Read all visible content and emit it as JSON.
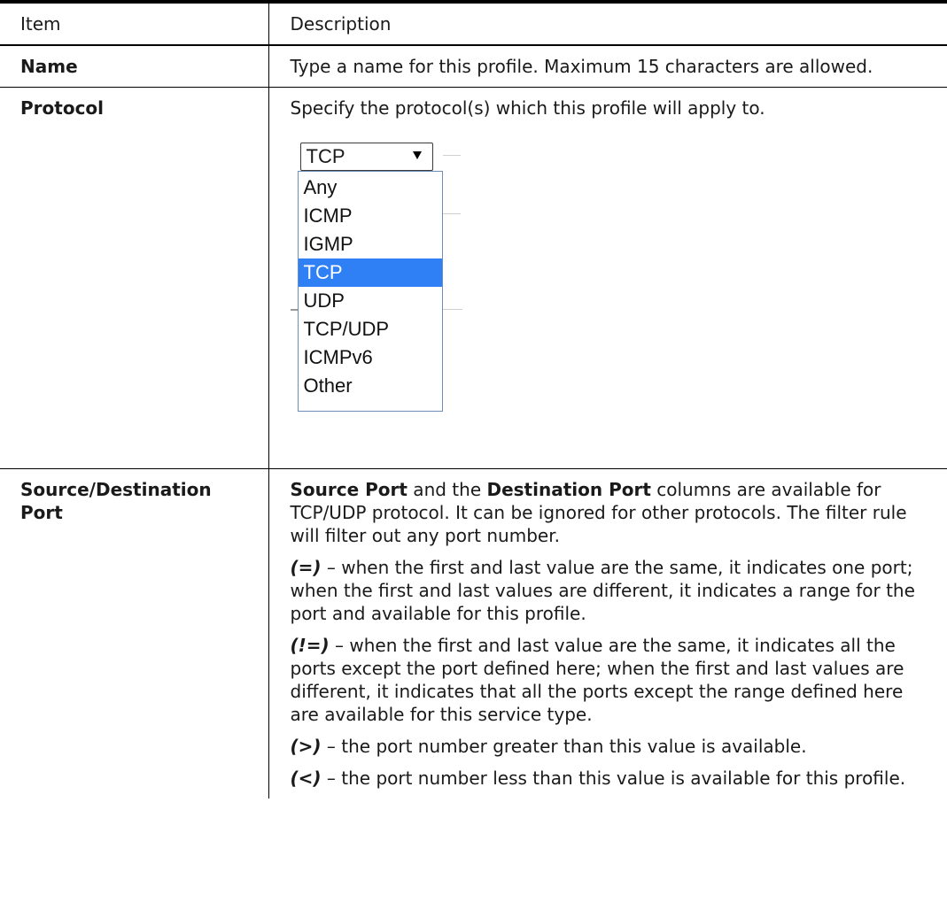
{
  "header": {
    "item": "Item",
    "description": "Description"
  },
  "rows": [
    {
      "item": "Name",
      "desc": "Type a name for this profile. Maximum 15 characters are allowed."
    },
    {
      "item": "Protocol",
      "desc": "Specify the protocol(s) which this profile will apply to.",
      "dropdown": {
        "selected": "TCP",
        "options": [
          "Any",
          "ICMP",
          "IGMP",
          "TCP",
          "UDP",
          "TCP/UDP",
          "ICMPv6",
          "Other"
        ],
        "highlighted": "TCP"
      }
    },
    {
      "item": "Source/Destination Port",
      "p1": {
        "b1": "Source Port",
        "t1": " and the ",
        "b2": "Destination Port",
        "t2": " columns are available for TCP/UDP protocol. It can be ignored for other protocols. The filter rule will filter out any port number."
      },
      "p2": {
        "sym": "(=)",
        "text": " – when the first and last value are the same, it indicates one port; when the first and last values are different, it indicates a range for the port and available for this profile."
      },
      "p3": {
        "sym": "(!=)",
        "text": " – when the first and last value are the same, it indicates all the ports except the port defined here; when the first and last values are different, it indicates that all the ports except the range defined here are available for this service type."
      },
      "p4": {
        "sym": "(>)",
        "text": " – the port number greater than this value is available."
      },
      "p5": {
        "sym": "(<)",
        "text": " – the port number less than this value is available for this profile."
      }
    }
  ]
}
